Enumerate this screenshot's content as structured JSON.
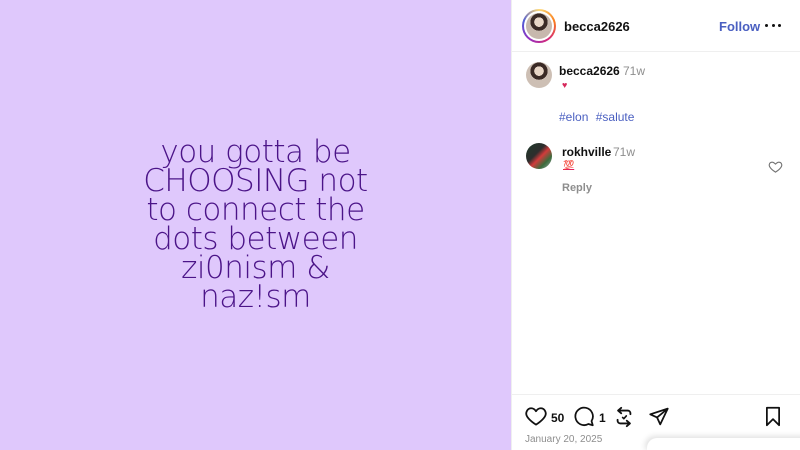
{
  "post": {
    "media_text": "you gotta be\nCHOOSING not\nto connect the\ndots between\nzi0nism &\nnaz!sm",
    "background_color": "#dfc8fc",
    "text_color": "#4b1488"
  },
  "header": {
    "username": "becca2626",
    "follow_label": "Follow",
    "more_icon": "more-horizontal-icon"
  },
  "caption": {
    "username": "becca2626",
    "time": "71w",
    "emoji": "♥",
    "hashtags": [
      "#elon",
      "#salute"
    ]
  },
  "comment": {
    "username": "rokhville",
    "time": "71w",
    "emoji": "💯",
    "reply_label": "Reply"
  },
  "actions": {
    "like_count": "50",
    "comment_count": "1",
    "date": "January 20, 2025"
  },
  "colors": {
    "link": "#4a5fc1",
    "muted": "#8e8e8e",
    "border": "#efefef"
  }
}
